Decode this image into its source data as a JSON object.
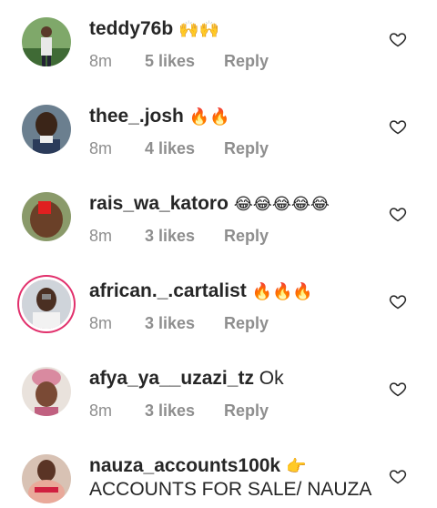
{
  "comments": [
    {
      "username": "teddy76b",
      "text": "🙌🙌",
      "time": "8m",
      "likes": "5 likes",
      "reply": "Reply"
    },
    {
      "username": "thee_.josh",
      "text": "🔥🔥",
      "time": "8m",
      "likes": "4 likes",
      "reply": "Reply"
    },
    {
      "username": "rais_wa_katoro",
      "text": "😂😂😂😂😂",
      "time": "8m",
      "likes": "3 likes",
      "reply": "Reply"
    },
    {
      "username": "african._.cartalist",
      "text": "🔥🔥🔥",
      "time": "8m",
      "likes": "3 likes",
      "reply": "Reply"
    },
    {
      "username": "afya_ya__uzazi_tz",
      "text": "Ok",
      "time": "8m",
      "likes": "3 likes",
      "reply": "Reply"
    },
    {
      "username": "nauza_accounts100k",
      "text": "👉",
      "text2": "ACCOUNTS FOR SALE/ NAUZA"
    }
  ],
  "colors": {
    "text": "#262626",
    "meta": "#8e8e8e",
    "story_ring": "#e1306c"
  },
  "icons": {
    "heart": "heart-outline-icon"
  }
}
